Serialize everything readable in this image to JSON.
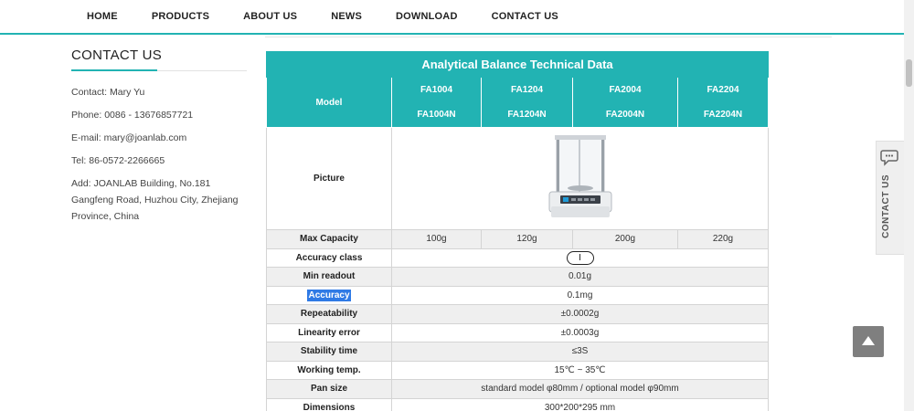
{
  "nav": {
    "items": [
      "HOME",
      "PRODUCTS",
      "ABOUT US",
      "NEWS",
      "DOWNLOAD",
      "CONTACT US"
    ]
  },
  "sidebar": {
    "title": "CONTACT US",
    "contact": "Contact: Mary Yu",
    "phone": "Phone: 0086 - 13676857721",
    "email": "E-mail: mary@joanlab.com",
    "tel": "Tel: 86-0572-2266665",
    "address": "Add: JOANLAB Building, No.181 Gangfeng Road, Huzhou City, Zhejiang Province, China"
  },
  "table": {
    "title": "Analytical Balance Technical Data",
    "model_label": "Model",
    "models": [
      {
        "top": "FA1004",
        "bottom": "FA1004N"
      },
      {
        "top": "FA1204",
        "bottom": "FA1204N"
      },
      {
        "top": "FA2004",
        "bottom": "FA2004N"
      },
      {
        "top": "FA2204",
        "bottom": "FA2204N"
      }
    ],
    "picture_label": "Picture",
    "max_capacity": {
      "label": "Max Capacity",
      "values": [
        "100g",
        "120g",
        "200g",
        "220g"
      ]
    },
    "accuracy_class": {
      "label": "Accuracy class",
      "value": "I"
    },
    "min_readout": {
      "label": "Min readout",
      "value": "0.01g"
    },
    "accuracy": {
      "label": "Accuracy",
      "value": "0.1mg"
    },
    "repeatability": {
      "label": "Repeatability",
      "value": "±0.0002g"
    },
    "linearity": {
      "label": "Linearity error",
      "value": "±0.0003g"
    },
    "stability": {
      "label": "Stability time",
      "value": "≤3S"
    },
    "working_temp": {
      "label": "Working temp.",
      "value": "15℃ ~ 35℃"
    },
    "pan_size": {
      "label": "Pan size",
      "value": "standard model φ80mm / optional model φ90mm"
    },
    "dimensions": {
      "label": "Dimensions",
      "value": "300*200*295 mm"
    }
  },
  "widgets": {
    "contact_tab": "CONTACT US",
    "chat_icon": "chat-bubble-icon",
    "back_to_top_icon": "arrow-up-icon"
  },
  "colors": {
    "accent": "#22b3b3",
    "selection": "#2f7ae5",
    "back_to_top": "#7f7f7f"
  }
}
